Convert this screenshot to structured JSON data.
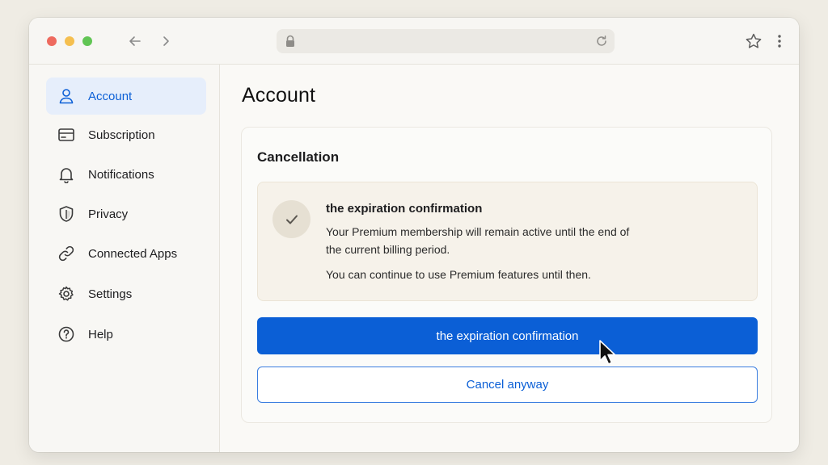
{
  "browser": {
    "url": "",
    "icons": {
      "back": "arrow-left-icon",
      "forward": "arrow-right-icon",
      "lock": "lock-icon",
      "reload": "reload-icon",
      "bookmark": "star-icon",
      "menu": "kebab-menu-icon"
    }
  },
  "sidebar": {
    "items": [
      {
        "label": "Account",
        "icon": "user-icon",
        "active": true
      },
      {
        "label": "Subscription",
        "icon": "credit-card-icon",
        "active": false
      },
      {
        "label": "Notifications",
        "icon": "bell-icon",
        "active": false
      },
      {
        "label": "Privacy",
        "icon": "shield-icon",
        "active": false
      },
      {
        "label": "Connected Apps",
        "icon": "link-icon",
        "active": false
      },
      {
        "label": "Settings",
        "icon": "gear-icon",
        "active": false
      },
      {
        "label": "Help",
        "icon": "question-icon",
        "active": false
      }
    ]
  },
  "main": {
    "title": "Account",
    "card": {
      "title": "Cancellation",
      "notice": {
        "title": "the expiration confirmation",
        "body": "Your Premium membership will remain active until the end of the current billing period.",
        "extra": "You can continue to use Premium features until then."
      },
      "primary_button": "the expiration confirmation",
      "secondary_button": "Cancel anyway"
    }
  },
  "colors": {
    "accent": "#0b5fd6",
    "active_bg": "#e6eefb",
    "notice_bg": "#f6f2ea"
  }
}
